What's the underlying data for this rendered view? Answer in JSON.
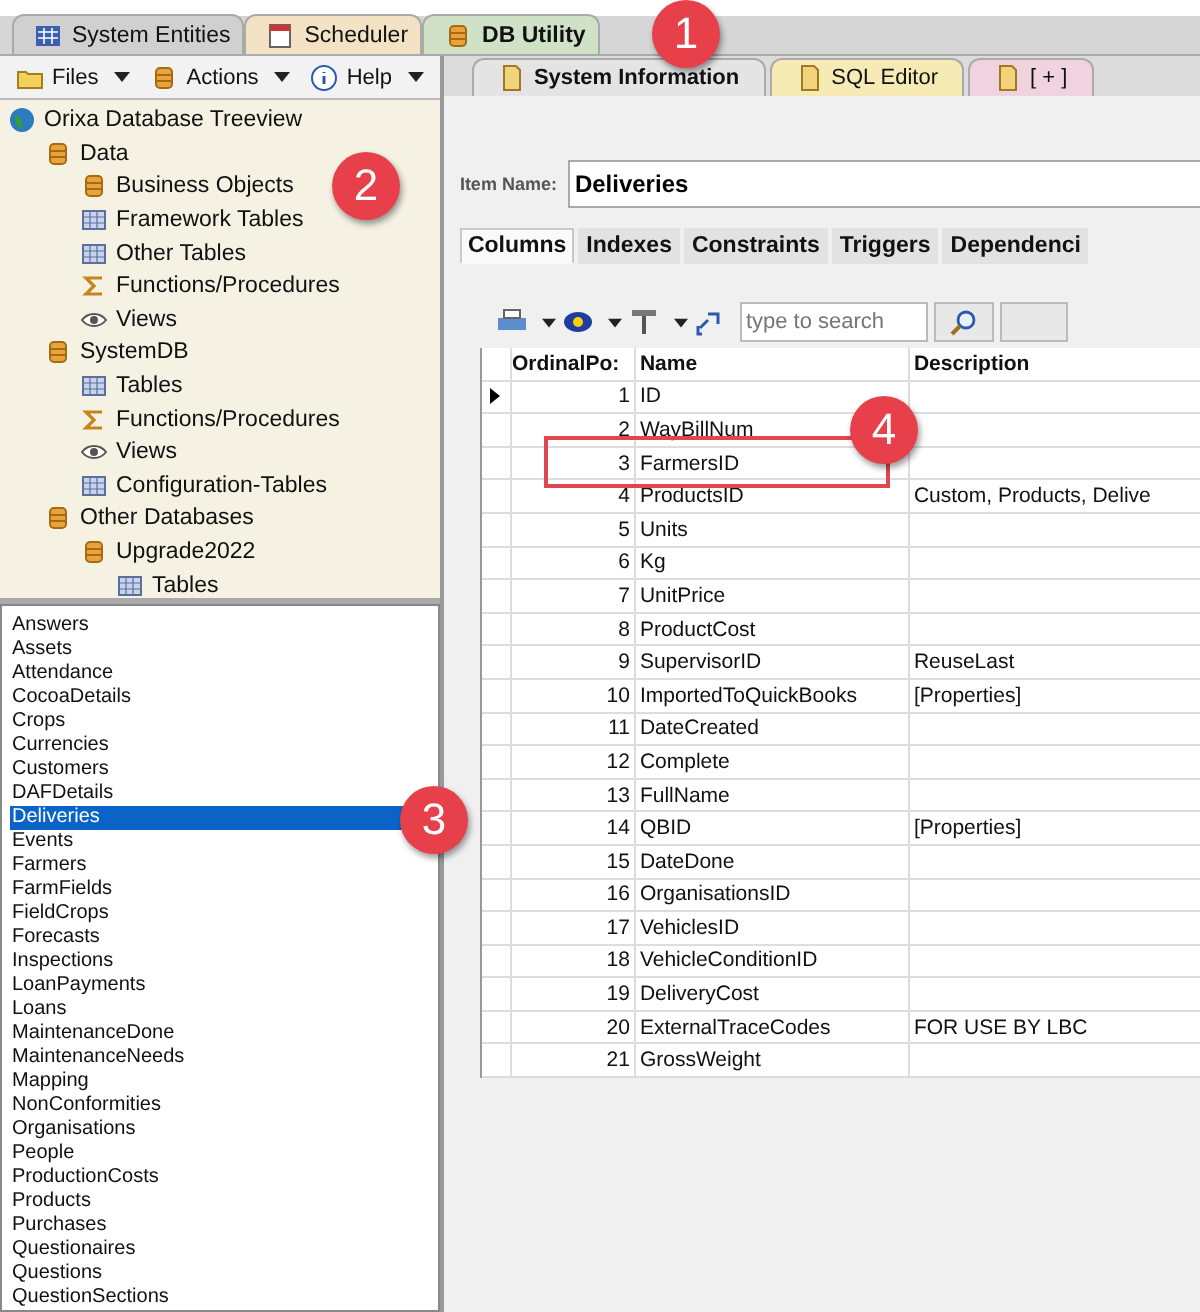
{
  "app_tabs": [
    {
      "label": "System Entities",
      "kind": "grid",
      "selected": false
    },
    {
      "label": "Scheduler",
      "kind": "calendar",
      "selected": false
    },
    {
      "label": "DB Utility",
      "kind": "database",
      "selected": true
    }
  ],
  "left_toolbar": [
    {
      "label": "Files",
      "kind": "folder"
    },
    {
      "label": "Actions",
      "kind": "database"
    },
    {
      "label": "Help",
      "kind": "info"
    }
  ],
  "tree": {
    "label": "Orixa Database Treeview",
    "kind": "globe",
    "children": [
      {
        "label": "Data",
        "kind": "database",
        "children": [
          {
            "label": "Business Objects",
            "kind": "database"
          },
          {
            "label": "Framework Tables",
            "kind": "table"
          },
          {
            "label": "Other Tables",
            "kind": "table"
          },
          {
            "label": "Functions/Procedures",
            "kind": "sigma"
          },
          {
            "label": "Views",
            "kind": "eye"
          }
        ]
      },
      {
        "label": "SystemDB",
        "kind": "database",
        "children": [
          {
            "label": "Tables",
            "kind": "table"
          },
          {
            "label": "Functions/Procedures",
            "kind": "sigma"
          },
          {
            "label": "Views",
            "kind": "eye"
          },
          {
            "label": "Configuration-Tables",
            "kind": "table"
          }
        ]
      },
      {
        "label": "Other Databases",
        "kind": "database",
        "children": [
          {
            "label": "Upgrade2022",
            "kind": "database",
            "children": [
              {
                "label": "Tables",
                "kind": "table"
              }
            ]
          }
        ]
      }
    ]
  },
  "table_list": [
    {
      "label": "Answers",
      "selected": false
    },
    {
      "label": "Assets",
      "selected": false
    },
    {
      "label": "Attendance",
      "selected": false
    },
    {
      "label": "CocoaDetails",
      "selected": false
    },
    {
      "label": "Crops",
      "selected": false
    },
    {
      "label": "Currencies",
      "selected": false
    },
    {
      "label": "Customers",
      "selected": false
    },
    {
      "label": "DAFDetails",
      "selected": false
    },
    {
      "label": "Deliveries",
      "selected": true
    },
    {
      "label": "Events",
      "selected": false
    },
    {
      "label": "Farmers",
      "selected": false
    },
    {
      "label": "FarmFields",
      "selected": false
    },
    {
      "label": "FieldCrops",
      "selected": false
    },
    {
      "label": "Forecasts",
      "selected": false
    },
    {
      "label": "Inspections",
      "selected": false
    },
    {
      "label": "LoanPayments",
      "selected": false
    },
    {
      "label": "Loans",
      "selected": false
    },
    {
      "label": "MaintenanceDone",
      "selected": false
    },
    {
      "label": "MaintenanceNeeds",
      "selected": false
    },
    {
      "label": "Mapping",
      "selected": false
    },
    {
      "label": "NonConformities",
      "selected": false
    },
    {
      "label": "Organisations",
      "selected": false
    },
    {
      "label": "People",
      "selected": false
    },
    {
      "label": "ProductionCosts",
      "selected": false
    },
    {
      "label": "Products",
      "selected": false
    },
    {
      "label": "Purchases",
      "selected": false
    },
    {
      "label": "Questionaires",
      "selected": false
    },
    {
      "label": "Questions",
      "selected": false
    },
    {
      "label": "QuestionSections",
      "selected": false
    }
  ],
  "doc_tabs": [
    {
      "label": "System Information",
      "color": "#e4e4e4",
      "selected": true
    },
    {
      "label": "SQL Editor",
      "color": "#f6ebb4",
      "selected": false
    },
    {
      "label": "[ + ]",
      "color": "#efd3de",
      "selected": false
    }
  ],
  "item_name": {
    "label": "Item Name:",
    "value": "Deliveries"
  },
  "sub_tabs": [
    {
      "label": "Columns",
      "selected": true
    },
    {
      "label": "Indexes",
      "selected": false
    },
    {
      "label": "Constraints",
      "selected": false
    },
    {
      "label": "Triggers",
      "selected": false
    },
    {
      "label": "Dependenci",
      "selected": false
    }
  ],
  "grid_search": {
    "placeholder": "type to search"
  },
  "grid": {
    "columns": [
      "OrdinalPo:",
      "Name",
      "Description"
    ],
    "rows": [
      {
        "cells": [
          "1",
          "ID",
          ""
        ],
        "selected": true
      },
      {
        "cells": [
          "2",
          "WayBillNum",
          ""
        ],
        "selected": false
      },
      {
        "cells": [
          "3",
          "FarmersID",
          ""
        ],
        "selected": false
      },
      {
        "cells": [
          "4",
          "ProductsID",
          "Custom, Products, Delive"
        ],
        "selected": false
      },
      {
        "cells": [
          "5",
          "Units",
          ""
        ],
        "selected": false
      },
      {
        "cells": [
          "6",
          "Kg",
          ""
        ],
        "selected": false
      },
      {
        "cells": [
          "7",
          "UnitPrice",
          ""
        ],
        "selected": false
      },
      {
        "cells": [
          "8",
          "ProductCost",
          ""
        ],
        "selected": false
      },
      {
        "cells": [
          "9",
          "SupervisorID",
          "ReuseLast"
        ],
        "selected": false
      },
      {
        "cells": [
          "10",
          "ImportedToQuickBooks",
          "[Properties]"
        ],
        "selected": false
      },
      {
        "cells": [
          "11",
          "DateCreated",
          ""
        ],
        "selected": false
      },
      {
        "cells": [
          "12",
          "Complete",
          ""
        ],
        "selected": false
      },
      {
        "cells": [
          "13",
          "FullName",
          ""
        ],
        "selected": false
      },
      {
        "cells": [
          "14",
          "QBID",
          "[Properties]"
        ],
        "selected": false
      },
      {
        "cells": [
          "15",
          "DateDone",
          ""
        ],
        "selected": false
      },
      {
        "cells": [
          "16",
          "OrganisationsID",
          ""
        ],
        "selected": false
      },
      {
        "cells": [
          "17",
          "VehiclesID",
          ""
        ],
        "selected": false
      },
      {
        "cells": [
          "18",
          "VehicleConditionID",
          ""
        ],
        "selected": false
      },
      {
        "cells": [
          "19",
          "DeliveryCost",
          ""
        ],
        "selected": false
      },
      {
        "cells": [
          "20",
          "ExternalTraceCodes",
          "FOR USE BY LBC"
        ],
        "selected": false
      },
      {
        "cells": [
          "21",
          "GrossWeight",
          ""
        ],
        "selected": false
      }
    ]
  },
  "callouts": [
    "1",
    "2",
    "3",
    "4"
  ]
}
